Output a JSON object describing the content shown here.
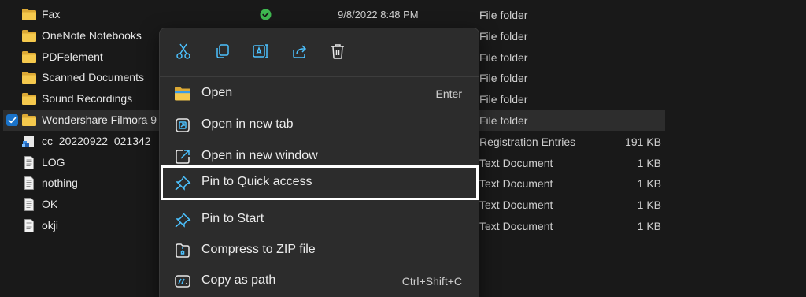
{
  "files": [
    {
      "name": "Fax",
      "date": "9/8/2022 8:48 PM",
      "type": "File folder",
      "size": "",
      "icon": "folder-icon",
      "status": "synced-check-icon"
    },
    {
      "name": "OneNote Notebooks",
      "date": "",
      "type": "File folder",
      "size": "",
      "icon": "folder-icon"
    },
    {
      "name": "PDFelement",
      "date": "",
      "type": "File folder",
      "size": "",
      "icon": "folder-icon"
    },
    {
      "name": "Scanned Documents",
      "date": "",
      "type": "File folder",
      "size": "",
      "icon": "folder-icon"
    },
    {
      "name": "Sound Recordings",
      "date": "",
      "type": "File folder",
      "size": "",
      "icon": "folder-icon"
    },
    {
      "name": "Wondershare Filmora 9",
      "date": "",
      "type": "File folder",
      "size": "",
      "icon": "folder-icon",
      "selected": true
    },
    {
      "name": "cc_20220922_021342",
      "date": "",
      "type": "Registration Entries",
      "size": "191 KB",
      "icon": "registry-file-icon"
    },
    {
      "name": "LOG",
      "date": "",
      "type": "Text Document",
      "size": "1 KB",
      "icon": "text-file-icon"
    },
    {
      "name": "nothing",
      "date": "",
      "type": "Text Document",
      "size": "1 KB",
      "icon": "text-file-icon"
    },
    {
      "name": "OK",
      "date": "",
      "type": "Text Document",
      "size": "1 KB",
      "icon": "text-file-icon"
    },
    {
      "name": "okji",
      "date": "",
      "type": "Text Document",
      "size": "1 KB",
      "icon": "text-file-icon"
    }
  ],
  "context_menu": {
    "toolbar": [
      {
        "name": "cut-icon"
      },
      {
        "name": "copy-icon"
      },
      {
        "name": "rename-icon"
      },
      {
        "name": "share-icon"
      },
      {
        "name": "delete-icon"
      }
    ],
    "items": [
      {
        "label": "Open",
        "shortcut": "Enter",
        "icon": "folder-open-icon"
      },
      {
        "label": "Open in new tab",
        "shortcut": "",
        "icon": "new-tab-icon"
      },
      {
        "label": "Open in new window",
        "shortcut": "",
        "icon": "new-window-icon"
      },
      {
        "label": "Pin to Quick access",
        "shortcut": "",
        "icon": "pin-icon",
        "highlighted": true
      },
      {
        "label": "Pin to Start",
        "shortcut": "",
        "icon": "pin-icon"
      },
      {
        "label": "Compress to ZIP file",
        "shortcut": "",
        "icon": "zip-icon"
      },
      {
        "label": "Copy as path",
        "shortcut": "Ctrl+Shift+C",
        "icon": "copy-path-icon"
      }
    ]
  },
  "colors": {
    "background": "#191919",
    "menu_background": "#2c2c2c",
    "folder": "#f0c64c",
    "accent": "#4cc2ff",
    "checkbox": "#1a73c9"
  }
}
